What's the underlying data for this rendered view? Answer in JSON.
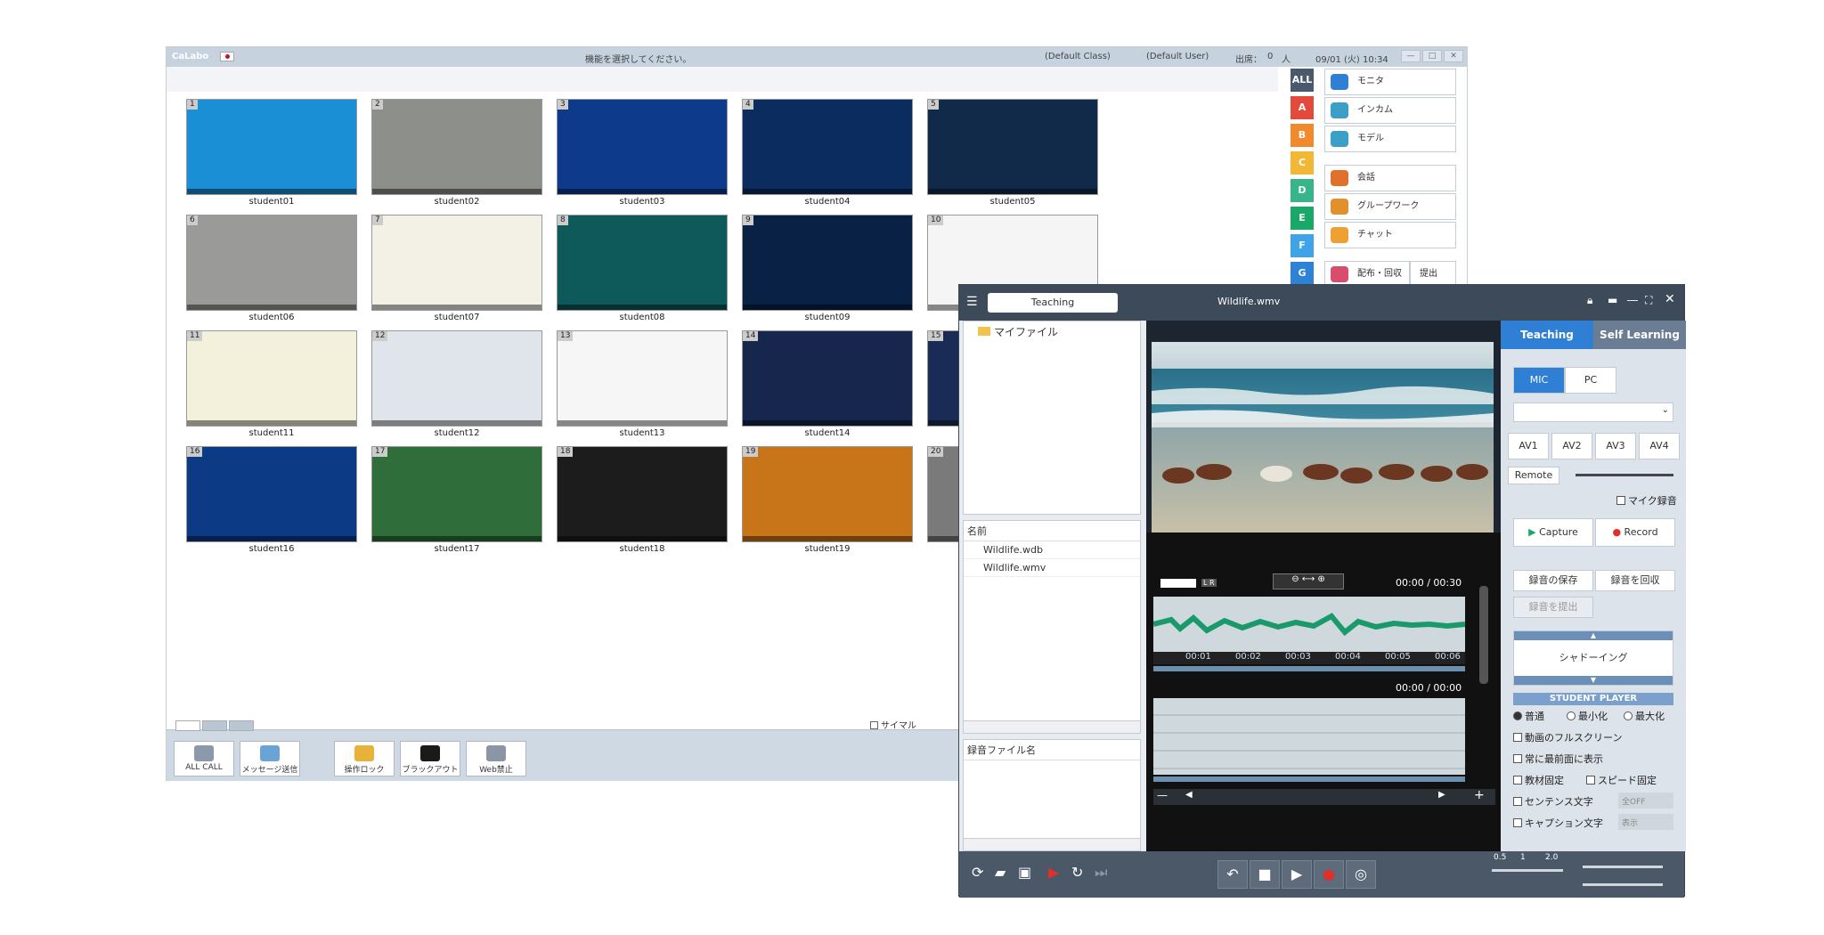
{
  "app": {
    "name": "CaLabo",
    "status_message": "機能を選択してください。",
    "class_name": "(Default Class)",
    "user_name": "(Default User)",
    "attendance_label": "出席：",
    "attendance_count": "0",
    "attendance_unit": "人",
    "datetime": "09/01 (火) 10:34"
  },
  "students": [
    {
      "num": "1",
      "name": "student01",
      "color": "#1a8fd6"
    },
    {
      "num": "2",
      "name": "student02",
      "color": "#8d8f8a"
    },
    {
      "num": "3",
      "name": "student03",
      "color": "#0d3a8a"
    },
    {
      "num": "4",
      "name": "student04",
      "color": "#0b2c5e"
    },
    {
      "num": "5",
      "name": "student05",
      "color": "#122a4a"
    },
    {
      "num": "6",
      "name": "student06",
      "color": "#9a9a98"
    },
    {
      "num": "7",
      "name": "student07",
      "color": "#f3f1e6"
    },
    {
      "num": "8",
      "name": "student08",
      "color": "#0e5a5a"
    },
    {
      "num": "9",
      "name": "student09",
      "color": "#0a2146"
    },
    {
      "num": "10",
      "name": "",
      "color": "#f5f5f5"
    },
    {
      "num": "11",
      "name": "student11",
      "color": "#f3f0dc"
    },
    {
      "num": "12",
      "name": "student12",
      "color": "#dfe5ea"
    },
    {
      "num": "13",
      "name": "student13",
      "color": "#f6f6f6"
    },
    {
      "num": "14",
      "name": "student14",
      "color": "#16264c"
    },
    {
      "num": "15",
      "name": "",
      "color": "#1a2c56"
    },
    {
      "num": "16",
      "name": "student16",
      "color": "#0d3a85"
    },
    {
      "num": "17",
      "name": "student17",
      "color": "#2f6d3a"
    },
    {
      "num": "18",
      "name": "student18",
      "color": "#1c1c1c"
    },
    {
      "num": "19",
      "name": "student19",
      "color": "#c8751a"
    },
    {
      "num": "20",
      "name": "",
      "color": "#7a7a7a"
    }
  ],
  "groups": [
    {
      "label": "ALL",
      "color": "#4a5a6c"
    },
    {
      "label": "A",
      "color": "#e44a3c"
    },
    {
      "label": "B",
      "color": "#f08a2c"
    },
    {
      "label": "C",
      "color": "#f2b734"
    },
    {
      "label": "D",
      "color": "#38b48a"
    },
    {
      "label": "E",
      "color": "#1aa868"
    },
    {
      "label": "F",
      "color": "#3fa3e8"
    },
    {
      "label": "G",
      "color": "#2c82d4"
    }
  ],
  "functions": [
    {
      "label": "モニタ",
      "icon": "binoculars-icon",
      "color": "#2f7fd4"
    },
    {
      "label": "インカム",
      "icon": "headset-icon",
      "color": "#3aa0c8"
    },
    {
      "label": "モデル",
      "icon": "person-model-icon",
      "color": "#3aa0c8"
    },
    {
      "label": "会話",
      "icon": "conversation-icon",
      "color": "#e0702c"
    },
    {
      "label": "グループワーク",
      "icon": "groupwork-icon",
      "color": "#e0902c"
    },
    {
      "label": "チャット",
      "icon": "chat-icon",
      "color": "#f0a030"
    },
    {
      "label": "配布・回収",
      "icon": "distribute-icon",
      "color": "#d84c6c"
    },
    {
      "label": "提出",
      "icon": "submit-icon",
      "color": "#888888"
    }
  ],
  "toolbar": {
    "allcall": "ALL CALL",
    "message": "メッセージ送信",
    "lock": "操作ロック",
    "blackout": "ブラックアウト",
    "webblock": "Web禁止",
    "thumbnail_check": "サイマル"
  },
  "player": {
    "tab_label": "Teaching",
    "file_title": "Wildlife.wmv",
    "folder": "マイファイル",
    "list_header": "名前",
    "files": [
      "Wildlife.wdb",
      "Wildlife.wmv"
    ],
    "rec_header": "録音ファイル名",
    "time_top": "00:00 / 00:30",
    "time_bottom": "00:00 / 00:00",
    "ticks": [
      "00:01",
      "00:02",
      "00:03",
      "00:04",
      "00:05",
      "00:06"
    ],
    "tab_teaching": "Teaching",
    "tab_self": "Self Learning",
    "mic": "MIC",
    "pc": "PC",
    "av": [
      "AV1",
      "AV2",
      "AV3",
      "AV4"
    ],
    "remote": "Remote",
    "mic_rec": "マイク録音",
    "capture": "Capture",
    "record": "Record",
    "save_rec": "録音の保存",
    "collect_rec": "録音を回収",
    "submit_rec": "録音を提出",
    "shadowing": "シャドーイング",
    "student_player": "STUDENT PLAYER",
    "view_normal": "普通",
    "view_min": "最小化",
    "view_max": "最大化",
    "fullscreen": "動画のフルスクリーン",
    "always_front": "常に最前面に表示",
    "fix_material": "教材固定",
    "fix_speed": "スピード固定",
    "sentence": "センテンス文字",
    "sentence_val": "全OFF",
    "caption": "キャプション文字",
    "caption_val": "表示",
    "speed_min": "0.5",
    "speed_mid": "1",
    "speed_max": "2.0"
  }
}
